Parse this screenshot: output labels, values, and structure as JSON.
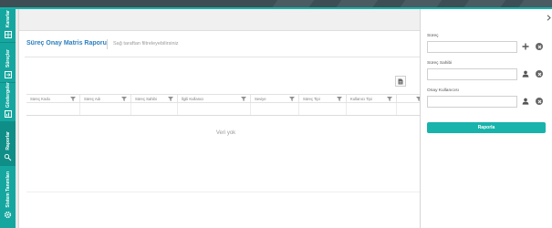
{
  "nav": {
    "items": [
      {
        "label": "Kararlar",
        "icon": "grid-icon"
      },
      {
        "label": "Süreçler",
        "icon": "process-icon"
      },
      {
        "label": "Göstergeler",
        "icon": "indicator-icon"
      },
      {
        "label": "Raporlar",
        "icon": "reports-icon"
      },
      {
        "label": "Sistem Tanımları",
        "icon": "gear-icon"
      }
    ],
    "active_index": 3
  },
  "report": {
    "title": "Süreç Onay Matris Raporu",
    "subtitle": "Sağ taraftan filtreleyebilirsiniz",
    "columns": [
      "Süreç Kodu",
      "Süreç Adı",
      "Süreç Sahibi",
      "İlgili Kullanıcı",
      "Seviye",
      "Süreç Tipi",
      "Kullanıcı Tipi",
      ""
    ],
    "empty_text": "Veri yok"
  },
  "filters": {
    "process_label": "Süreç",
    "owner_label": "Süreç Sahibi",
    "approver_label": "Onay Kullanıcısı",
    "report_button": "Raporla"
  },
  "colors": {
    "accent": "#15a79f",
    "title": "#2d7fbf",
    "button": "#18b3ab"
  }
}
